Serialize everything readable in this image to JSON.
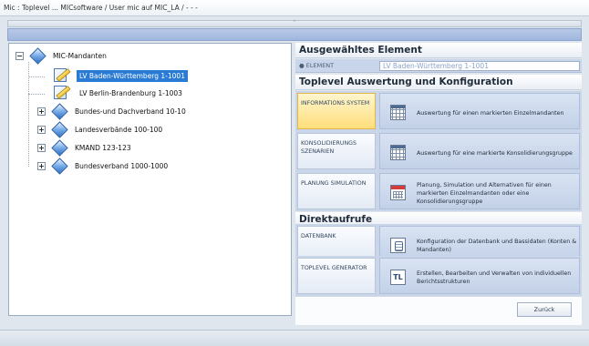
{
  "window": {
    "title": "Mic : Toplevel ...  MICsoftware / User mic auf MIC_LA /  - - -"
  },
  "collapse_glyph": "˄",
  "tree": {
    "root": {
      "label": "MIC-Mandanten",
      "expander": "−"
    },
    "children": [
      {
        "label": "LV Baden-Württemberg 1-1001",
        "icon": "document-edit-icon",
        "selected": true
      },
      {
        "label": "LV Berlin-Brandenburg 1-1003",
        "icon": "document-edit-icon",
        "selected": false
      },
      {
        "label": "Bundes-und Dachverband 10-10",
        "icon": "diamond-icon",
        "expander": "+"
      },
      {
        "label": "Landesverbände 100-100",
        "icon": "diamond-icon",
        "expander": "+"
      },
      {
        "label": "KMAND 123-123",
        "icon": "diamond-icon",
        "expander": "+"
      },
      {
        "label": "Bundesverband 1000-1000",
        "icon": "diamond-icon",
        "expander": "+"
      }
    ]
  },
  "selected_element": {
    "heading": "Ausgewähltes Element",
    "label": "ELEMENT",
    "value": "LV Baden-Württemberg 1-1001"
  },
  "toplevel": {
    "heading": "Toplevel Auswertung und Konfiguration",
    "actions": [
      {
        "button": "INFORMATIONS SYSTEM",
        "description": "Auswertung für einen markierten Einzelmandanten",
        "icon": "table-icon",
        "active": true
      },
      {
        "button": "KONSOLIDIERUNGS SZENARIEN",
        "description": "Auswertung für eine markierte Konsolidierungsgruppe",
        "icon": "table-icon",
        "active": false
      },
      {
        "button": "PLANUNG SIMULATION",
        "description": "Planung, Simulation und Alternativen für einen markierten Einzelmandanten oder eine Konsolidierungsgruppe",
        "icon": "calendar-icon",
        "active": false
      }
    ]
  },
  "direct": {
    "heading": "Direktaufrufe",
    "actions": [
      {
        "button": "DATENBANK",
        "description": "Konfiguration der Datenbank und Bassidaten (Konten & Mandanten)",
        "icon": "database-icon"
      },
      {
        "button": "TOPLEVEL GENERATOR",
        "description": "Erstellen, Bearbeiten und Verwalten von individuellen Berichtsstrukturen",
        "icon": "tl-generator-icon",
        "icon_text": "TL"
      }
    ]
  },
  "back_button": "Zurück"
}
